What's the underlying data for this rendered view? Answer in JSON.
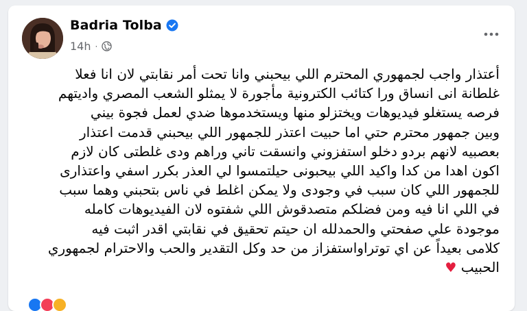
{
  "post": {
    "author": "Badria Tolba",
    "time": "14h",
    "separator": "·",
    "lines": [
      "أعتذار واجب لجمهوري المحترم اللي بيحبني وانا تحت أمر نقابتي لان انا فعلا",
      "غلطانة انى انساق ورا كتائب الكترونية مأجورة لا يمثلو الشعب المصري واديتهم",
      "فرصه يستغلو فيديوهات ويختزلو منها ويستخدموها ضدي لعمل فجوة بيني",
      "وبين جمهور محترم حتي اما حبيت اعتذر للجمهور اللي بيحبني قدمت اعتذار",
      "بعصبيه لانهم بردو دخلو استفزوني وانسقت تاني وراهم ودى غلطتى كان لازم",
      "اكون اهدا من كدا واكيد اللي بيحبونى حيلتمسوا لي العذر بكرر اسفي واعتذارى",
      "للجمهور اللي كان سبب في وجودى ولا يمكن اغلط في ناس بتحبني وهما سبب",
      "في اللي انا فيه ومن فضلكم متصدقوش اللي شفتوه لان الفيديوهات كامله",
      "موجودة علي صفحتي والحمدلله ان حيتم تحقيق في نقابتي اقدر اثبت فيه",
      "كلامى بعيداً عن اي توتراواستفزاز من حد وكل التقدير والحب والاحترام لجمهوري",
      "الحبيب"
    ],
    "heart_emoji": "♥",
    "icons": {
      "verified": "verified-badge-icon",
      "audience": "globe-icon",
      "more": "more-options-icon"
    },
    "colors": {
      "verified": "#1877f2",
      "meta": "#65676b",
      "heart": "#e41e3f"
    }
  }
}
